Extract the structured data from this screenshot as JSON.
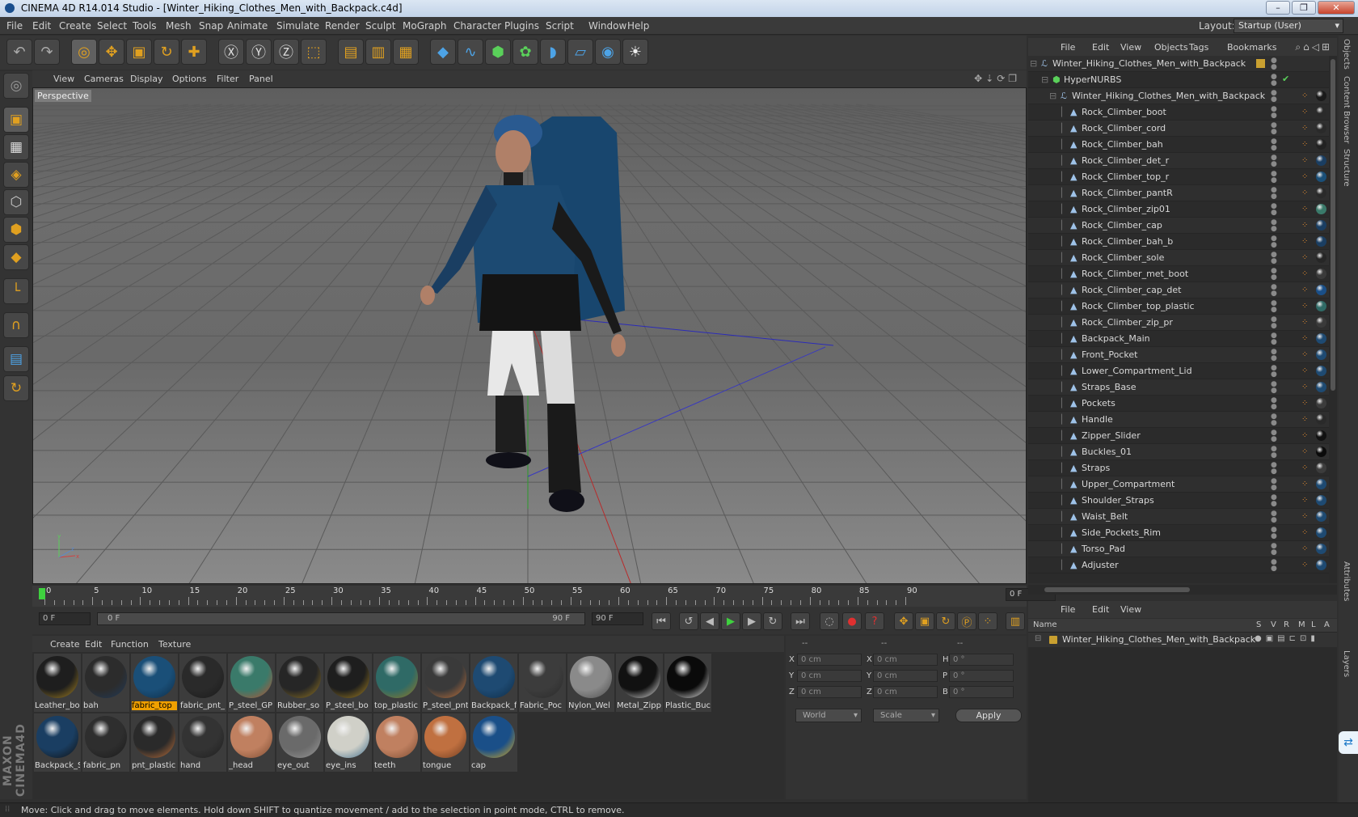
{
  "window": {
    "title": "CINEMA 4D R14.014 Studio - [Winter_Hiking_Clothes_Men_with_Backpack.c4d]",
    "controls": [
      "–",
      "❐",
      "✕"
    ]
  },
  "menubar": {
    "items": [
      "File",
      "Edit",
      "Create",
      "Select",
      "Tools",
      "Mesh",
      "Snap",
      "Animate",
      "Simulate",
      "Render",
      "Sculpt",
      "MoGraph",
      "Character",
      "Plugins",
      "Script",
      "Window",
      "Help"
    ],
    "layout_label": "Layout:",
    "layout_value": "Startup (User)"
  },
  "toolbar": {
    "icons": [
      "undo-icon",
      "redo-icon",
      "live-selection-icon",
      "move-icon",
      "scale-icon",
      "rotate-icon",
      "add-object-icon",
      "x-axis-icon",
      "y-axis-icon",
      "z-axis-icon",
      "coordinate-system-icon",
      "render-view-icon",
      "render-picture-viewer-icon",
      "edit-render-settings-icon",
      "cube-icon",
      "spline-pen-icon",
      "nurbs-icon",
      "array-icon",
      "deformer-icon",
      "floor-icon",
      "camera-icon",
      "light-icon"
    ],
    "axis_labels": [
      "X",
      "Y",
      "Z"
    ]
  },
  "viewport": {
    "menus": [
      "View",
      "Cameras",
      "Display",
      "Options",
      "Filter",
      "Panel"
    ],
    "label": "Perspective",
    "axis_x": "x",
    "axis_y": "y",
    "axis_z": "z"
  },
  "timeline": {
    "ticks": [
      "0",
      "5",
      "10",
      "15",
      "20",
      "25",
      "30",
      "35",
      "40",
      "45",
      "50",
      "55",
      "60",
      "65",
      "70",
      "75",
      "80",
      "85",
      "90"
    ],
    "current_frame": "0 F"
  },
  "transport": {
    "start_field": "0 F",
    "range_start": "0 F",
    "range_end": "90 F",
    "end_field": "90 F"
  },
  "materials": {
    "menus": [
      "Create",
      "Edit",
      "Function",
      "Texture"
    ],
    "selected_index": 2,
    "items": [
      {
        "label": "Leather_bo",
        "color": "#1e1e1e",
        "accent": "#b08a20"
      },
      {
        "label": "bah",
        "color": "#2c2c2c",
        "accent": "#203a5a"
      },
      {
        "label": "fabric_top",
        "color": "#1a4f78",
        "accent": "#0e2c46"
      },
      {
        "label": "fabric_pnt_",
        "color": "#2a2a2a",
        "accent": "#1a1a1a"
      },
      {
        "label": "P_steel_GP",
        "color": "#3a7a6a",
        "accent": "#c05030"
      },
      {
        "label": "Rubber_so",
        "color": "#262626",
        "accent": "#9a7a20"
      },
      {
        "label": "P_steel_bo",
        "color": "#1e1e1e",
        "accent": "#b08a20"
      },
      {
        "label": "top_plastic",
        "color": "#2f6a66",
        "accent": "#9a7a20"
      },
      {
        "label": "P_steel_pnt",
        "color": "#3a3a3a",
        "accent": "#c8743a"
      },
      {
        "label": "Backpack_f",
        "color": "#1e4a72",
        "accent": "#0e2c46"
      },
      {
        "label": "Fabric_Poc",
        "color": "#3c3c3c",
        "accent": "#2a2a2a"
      },
      {
        "label": "Nylon_Wel",
        "color": "#8a8a8a",
        "accent": "#4a4a4a"
      },
      {
        "label": "Metal_Zipp",
        "color": "#111111",
        "accent": "#f0f0f0"
      },
      {
        "label": "Plastic_Buc",
        "color": "#0a0a0a",
        "accent": "#ffffff"
      },
      {
        "label": "Backpack_S",
        "color": "#1a3e62",
        "accent": "#101010"
      },
      {
        "label": "fabric_pn",
        "color": "#2e2e2e",
        "accent": "#1a1a1a"
      },
      {
        "label": "pnt_plastic",
        "color": "#2a2a2a",
        "accent": "#c8743a"
      },
      {
        "label": "hand",
        "color": "#333333",
        "accent": "#1e1e1e"
      },
      {
        "label": "_head",
        "color": "#c08060",
        "accent": "#7a4a30"
      },
      {
        "label": "eye_out",
        "color": "#6a6a6a",
        "accent": "#9a9a9a"
      },
      {
        "label": "eye_ins",
        "color": "#d0d0c8",
        "accent": "#3a6a8a"
      },
      {
        "label": "teeth",
        "color": "#c08060",
        "accent": "#7a4a30"
      },
      {
        "label": "tongue",
        "color": "#c07040",
        "accent": "#6a3a20"
      },
      {
        "label": "cap",
        "color": "#1a4f88",
        "accent": "#e0b020"
      }
    ]
  },
  "coordinates": {
    "headers": [
      "--",
      "--",
      "--"
    ],
    "rows": [
      {
        "a": "X",
        "v1": "0 cm",
        "b": "X",
        "v2": "0 cm",
        "c": "H",
        "v3": "0 °"
      },
      {
        "a": "Y",
        "v1": "0 cm",
        "b": "Y",
        "v2": "0 cm",
        "c": "P",
        "v3": "0 °"
      },
      {
        "a": "Z",
        "v1": "0 cm",
        "b": "Z",
        "v2": "0 cm",
        "c": "B",
        "v3": "0 °"
      }
    ],
    "mode_world": "World",
    "mode_scale": "Scale",
    "apply": "Apply"
  },
  "object_manager": {
    "menus": [
      "File",
      "Edit",
      "View",
      "Objects",
      "Tags",
      "Bookmarks"
    ],
    "objects": [
      {
        "name": "Winter_Hiking_Clothes_Men_with_Backpack",
        "level": 0,
        "icon": "null",
        "ball": ""
      },
      {
        "name": "HyperNURBS",
        "level": 1,
        "icon": "nurbs",
        "ball": ""
      },
      {
        "name": "Winter_Hiking_Clothes_Men_with_Backpack",
        "level": 2,
        "icon": "null",
        "ball": "#1a1a1a"
      },
      {
        "name": "Rock_Climber_boot",
        "level": 3,
        "icon": "poly",
        "ball": "#2a2a2a"
      },
      {
        "name": "Rock_Climber_cord",
        "level": 3,
        "icon": "poly",
        "ball": "#2a2a2a"
      },
      {
        "name": "Rock_Climber_bah",
        "level": 3,
        "icon": "poly",
        "ball": "#222"
      },
      {
        "name": "Rock_Climber_det_r",
        "level": 3,
        "icon": "poly",
        "ball": "#1a3e62"
      },
      {
        "name": "Rock_Climber_top_r",
        "level": 3,
        "icon": "poly",
        "ball": "#1a4f78"
      },
      {
        "name": "Rock_Climber_pantR",
        "level": 3,
        "icon": "poly",
        "ball": "#2a2a2a"
      },
      {
        "name": "Rock_Climber_zip01",
        "level": 3,
        "icon": "poly",
        "ball": "#3a7a6a"
      },
      {
        "name": "Rock_Climber_cap",
        "level": 3,
        "icon": "poly",
        "ball": "#1a3e62"
      },
      {
        "name": "Rock_Climber_bah_b",
        "level": 3,
        "icon": "poly",
        "ball": "#1a3e62"
      },
      {
        "name": "Rock_Climber_sole",
        "level": 3,
        "icon": "poly",
        "ball": "#262626"
      },
      {
        "name": "Rock_Climber_met_boot",
        "level": 3,
        "icon": "poly",
        "ball": "#3a3a3a"
      },
      {
        "name": "Rock_Climber_cap_det",
        "level": 3,
        "icon": "poly",
        "ball": "#1a4f88"
      },
      {
        "name": "Rock_Climber_top_plastic",
        "level": 3,
        "icon": "poly",
        "ball": "#2f6a66"
      },
      {
        "name": "Rock_Climber_zip_pr",
        "level": 3,
        "icon": "poly",
        "ball": "#3a3a3a"
      },
      {
        "name": "Backpack_Main",
        "level": 3,
        "icon": "poly",
        "ball": "#1e4a72"
      },
      {
        "name": "Front_Pocket",
        "level": 3,
        "icon": "poly",
        "ball": "#1e4a72"
      },
      {
        "name": "Lower_Compartment_Lid",
        "level": 3,
        "icon": "poly",
        "ball": "#1e4a72"
      },
      {
        "name": "Straps_Base",
        "level": 3,
        "icon": "poly",
        "ball": "#1e4a72"
      },
      {
        "name": "Pockets",
        "level": 3,
        "icon": "poly",
        "ball": "#3c3c3c"
      },
      {
        "name": "Handle",
        "level": 3,
        "icon": "poly",
        "ball": "#2a2a2a"
      },
      {
        "name": "Zipper_Slider",
        "level": 3,
        "icon": "poly",
        "ball": "#111"
      },
      {
        "name": "Buckles_01",
        "level": 3,
        "icon": "poly",
        "ball": "#0a0a0a"
      },
      {
        "name": "Straps",
        "level": 3,
        "icon": "poly",
        "ball": "#3c3c3c"
      },
      {
        "name": "Upper_Compartment",
        "level": 3,
        "icon": "poly",
        "ball": "#1e4a72"
      },
      {
        "name": "Shoulder_Straps",
        "level": 3,
        "icon": "poly",
        "ball": "#1e4a72"
      },
      {
        "name": "Waist_Belt",
        "level": 3,
        "icon": "poly",
        "ball": "#1e4a72"
      },
      {
        "name": "Side_Pockets_Rim",
        "level": 3,
        "icon": "poly",
        "ball": "#1e4a72"
      },
      {
        "name": "Torso_Pad",
        "level": 3,
        "icon": "poly",
        "ball": "#1e4a72"
      },
      {
        "name": "Adjuster",
        "level": 3,
        "icon": "poly",
        "ball": "#1e4a72"
      }
    ]
  },
  "attribute_manager": {
    "menus": [
      "File",
      "Edit",
      "View"
    ],
    "columns": [
      "Name",
      "S",
      "V",
      "R",
      "M",
      "L",
      "A"
    ],
    "object": "Winter_Hiking_Clothes_Men_with_Backpack"
  },
  "sidetabs": [
    "Objects",
    "Content Browser",
    "Structure",
    "Attributes",
    "Layers"
  ],
  "status": "Move: Click and drag to move elements. Hold down SHIFT to quantize movement / add to the selection in point mode, CTRL to remove."
}
